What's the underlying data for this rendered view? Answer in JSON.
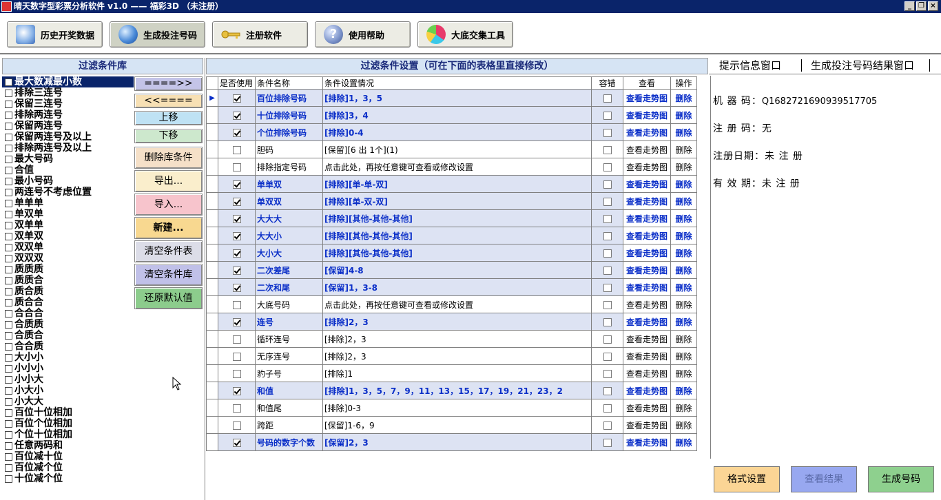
{
  "window": {
    "title": "晴天数字型彩票分析软件 v1.0 —— 福彩3D  （未注册）",
    "minimize": "_",
    "restore": "❐",
    "close": "×"
  },
  "toolbar": [
    {
      "label": "历史开奖数据",
      "icon": "newspaper-globe-icon"
    },
    {
      "label": "生成投注号码",
      "icon": "globe-icon",
      "active": true
    },
    {
      "label": "注册软件",
      "icon": "key-icon"
    },
    {
      "label": "使用帮助",
      "icon": "help-icon"
    },
    {
      "label": "大底交集工具",
      "icon": "pie-chart-icon"
    }
  ],
  "library": {
    "title": "过滤条件库",
    "items": [
      "最大数减最小数",
      "排除三连号",
      "保留三连号",
      "排除两连号",
      "保留两连号",
      "保留两连号及以上",
      "排除两连号及以上",
      "最大号码",
      "合值",
      "最小号码",
      "两连号不考虑位置",
      "单单单",
      "单双单",
      "双单单",
      "双单双",
      "双双单",
      "双双双",
      "质质质",
      "质质合",
      "质合质",
      "质合合",
      "合合合",
      "合质质",
      "合质合",
      "合合质",
      "大小小",
      "小小小",
      "小小大",
      "小大小",
      "小大大",
      "百位十位相加",
      "百位个位相加",
      "个位十位相加",
      "任意两码和",
      "百位减十位",
      "百位减个位",
      "十位减个位"
    ],
    "selected_index": 0,
    "buttons": [
      {
        "label": "====>>",
        "color": "#c4c4e8"
      },
      {
        "label": "<<====",
        "color": "#f7e0b4"
      },
      {
        "label": "上移",
        "color": "#bfe2f4"
      },
      {
        "label": "下移",
        "color": "#cde8cd"
      },
      {
        "label": "删除库条件",
        "color": "#f5e0c8"
      },
      {
        "label": "导出...",
        "color": "#faeecc"
      },
      {
        "label": "导入...",
        "color": "#f7c4cc"
      },
      {
        "label": "新建...",
        "color": "#f8d890"
      },
      {
        "label": "清空条件表",
        "color": "#dcdde8"
      },
      {
        "label": "清空条件库",
        "color": "#c0c0e8"
      },
      {
        "label": "还原默认值",
        "color": "#8ccc8c"
      }
    ]
  },
  "grid": {
    "title": "过滤条件设置（可在下面的表格里直接修改）",
    "columns": [
      "是否使用",
      "条件名称",
      "条件设置情况",
      "容错",
      "查看",
      "操作"
    ],
    "view_label": "查看走势图",
    "delete_label": "删除",
    "rows": [
      {
        "on": true,
        "name": "百位排除号码",
        "setting": "[排除]1，3，5"
      },
      {
        "on": true,
        "name": "十位排除号码",
        "setting": "[排除]3，4"
      },
      {
        "on": true,
        "name": "个位排除号码",
        "setting": "[排除]0-4"
      },
      {
        "on": false,
        "name": "胆码",
        "setting": "[保留][6 出 1个](1)"
      },
      {
        "on": false,
        "name": "排除指定号码",
        "setting": "点击此处，再按任意键可查看或修改设置"
      },
      {
        "on": true,
        "name": "单单双",
        "setting": "[排除][单-单-双]"
      },
      {
        "on": true,
        "name": "单双双",
        "setting": "[排除][单-双-双]"
      },
      {
        "on": true,
        "name": "大大大",
        "setting": "[排除][其他-其他-其他]"
      },
      {
        "on": true,
        "name": "大大小",
        "setting": "[排除][其他-其他-其他]"
      },
      {
        "on": true,
        "name": "大小大",
        "setting": "[排除][其他-其他-其他]"
      },
      {
        "on": true,
        "name": "二次差尾",
        "setting": "[保留]4-8"
      },
      {
        "on": true,
        "name": "二次和尾",
        "setting": "[保留]1，3-8"
      },
      {
        "on": false,
        "name": "大底号码",
        "setting": "点击此处，再按任意键可查看或修改设置"
      },
      {
        "on": true,
        "name": "连号",
        "setting": "[排除]2，3"
      },
      {
        "on": false,
        "name": "循环连号",
        "setting": "[排除]2，3"
      },
      {
        "on": false,
        "name": "无序连号",
        "setting": "[排除]2，3"
      },
      {
        "on": false,
        "name": "豹子号",
        "setting": "[排除]1"
      },
      {
        "on": true,
        "name": "和值",
        "setting": "[排除]1，3，5，7，9，11，13，15，17，19，21，23，2"
      },
      {
        "on": false,
        "name": "和值尾",
        "setting": "[排除]0-3"
      },
      {
        "on": false,
        "name": "跨距",
        "setting": "[保留]1-6，9"
      },
      {
        "on": true,
        "name": "号码的数字个数",
        "setting": "[保留]2，3"
      }
    ],
    "current_row": 0
  },
  "right": {
    "tabs": [
      "提示信息窗口",
      "生成投注号码结果窗口"
    ],
    "info": [
      {
        "label": "机 器 码：",
        "value": "Q1682721690939517705"
      },
      {
        "label": "注 册 码：",
        "value": "无"
      },
      {
        "label": "注册日期：",
        "value": "未 注 册"
      },
      {
        "label": "有 效 期：",
        "value": "未 注 册"
      }
    ],
    "buttons": [
      {
        "label": "格式设置",
        "color": "#fbd595",
        "text_color": "#000"
      },
      {
        "label": "查看结果",
        "color": "#98a8f0",
        "text_color": "#5a6aa8"
      },
      {
        "label": "生成号码",
        "color": "#8ed08e",
        "text_color": "#000"
      }
    ]
  }
}
